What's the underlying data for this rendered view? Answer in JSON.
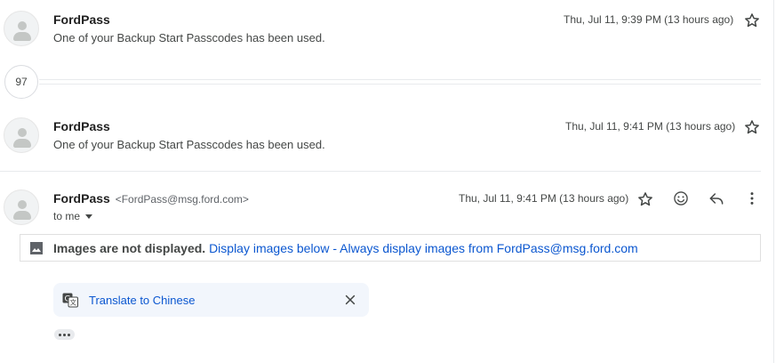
{
  "thread": {
    "collapsed_count": "97",
    "messages": [
      {
        "sender": "FordPass",
        "snippet": "One of your Backup Start Passcodes has been used.",
        "date": "Thu, Jul 11, 9:39 PM (13 hours ago)"
      },
      {
        "sender": "FordPass",
        "snippet": "One of your Backup Start Passcodes has been used.",
        "date": "Thu, Jul 11, 9:41 PM (13 hours ago)"
      }
    ],
    "open_message": {
      "sender": "FordPass",
      "email": "<FordPass@msg.ford.com>",
      "date": "Thu, Jul 11, 9:41 PM (13 hours ago)",
      "recipient": "to me",
      "images_notice": "Images are not displayed.",
      "display_below": "Display images below",
      "separator": " - ",
      "always_display": "Always display images from FordPass@msg.ford.com",
      "translate_label": "Translate to Chinese"
    }
  },
  "icons": {
    "star": "star-icon",
    "emoji": "emoji-icon",
    "reply": "reply-icon",
    "more": "more-vert-icon",
    "image": "image-icon",
    "translate": "translate-icon",
    "close": "close-icon"
  },
  "colors": {
    "link": "#0b57d0",
    "divider": "#e8eaed",
    "translate_bg": "#f2f6fc"
  }
}
